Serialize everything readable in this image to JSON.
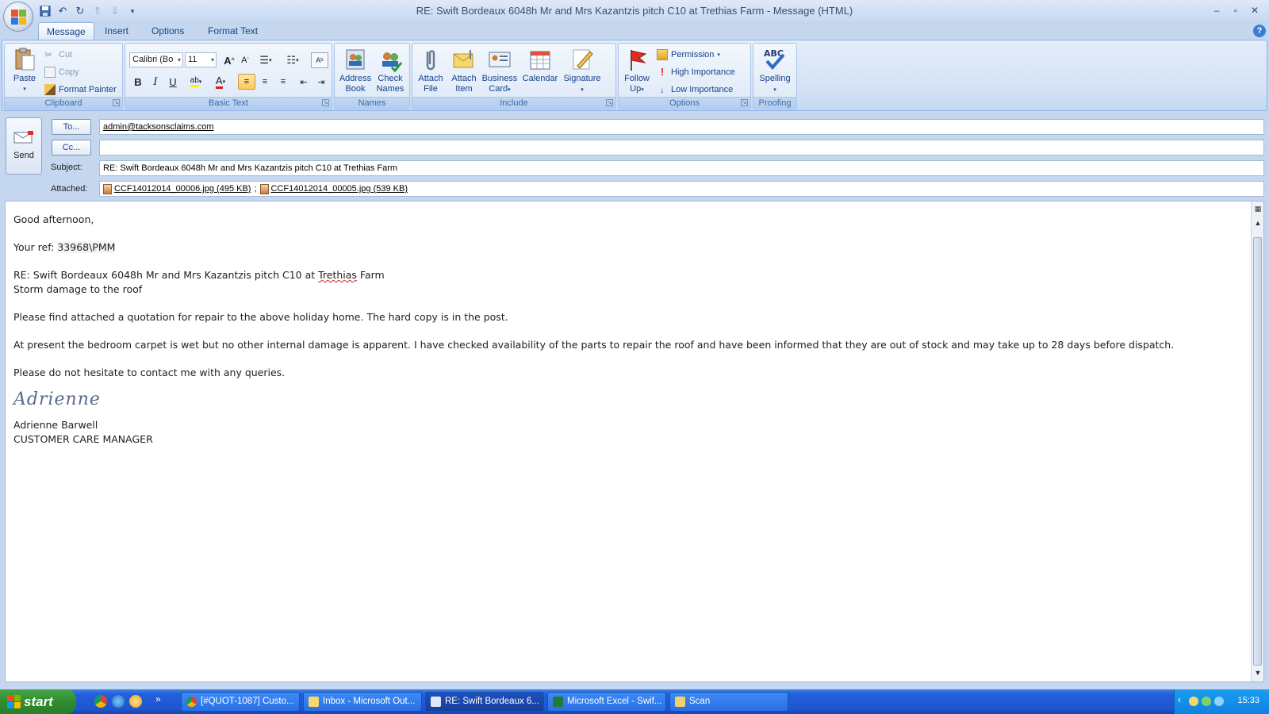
{
  "window": {
    "title": "RE: Swift Bordeaux 6048h Mr and Mrs Kazantzis pitch C10 at Trethias Farm - Message (HTML)",
    "controls": [
      "–",
      "▫",
      "✕"
    ]
  },
  "tabs": [
    "Message",
    "Insert",
    "Options",
    "Format Text"
  ],
  "ribbon": {
    "clipboard": {
      "label": "Clipboard",
      "paste": "Paste",
      "cut": "Cut",
      "copy": "Copy",
      "format_painter": "Format Painter"
    },
    "basic_text": {
      "label": "Basic Text",
      "font": "Calibri (Bo",
      "size": "11"
    },
    "names": {
      "label": "Names",
      "address_book": [
        "Address",
        "Book"
      ],
      "check_names": [
        "Check",
        "Names"
      ]
    },
    "include": {
      "label": "Include",
      "attach_file": [
        "Attach",
        "File"
      ],
      "attach_item": [
        "Attach",
        "Item"
      ],
      "business_card": [
        "Business",
        "Card"
      ],
      "calendar": "Calendar",
      "signature": "Signature"
    },
    "options": {
      "label": "Options",
      "follow_up": [
        "Follow",
        "Up"
      ],
      "permission": "Permission",
      "high_importance": "High Importance",
      "low_importance": "Low Importance"
    },
    "proofing": {
      "label": "Proofing",
      "spelling": "Spelling",
      "abc": "ABC"
    }
  },
  "header": {
    "send": "Send",
    "to_button": "To...",
    "cc_button": "Cc...",
    "subject_label": "Subject:",
    "attached_label": "Attached:",
    "to_value": "admin@tacksonsclaims.com",
    "cc_value": "",
    "subject_value": "RE: Swift Bordeaux 6048h Mr and Mrs Kazantzis pitch C10 at Trethias Farm",
    "attachments": [
      "CCF14012014_00006.jpg (495 KB)",
      "CCF14012014_00005.jpg (539 KB)"
    ],
    "attachment_separator": ";"
  },
  "message": {
    "greeting": "Good afternoon,",
    "ref_prefix": "Your ref: ",
    "ref_value": "33968\\PMM",
    "re_line_a": "RE: Swift Bordeaux 6048h Mr and Mrs Kazantzis pitch C10 at ",
    "re_line_b": "Trethias",
    "re_line_c": " Farm",
    "storm_line": "Storm damage to the roof",
    "para1": "Please find attached a quotation for repair to the above holiday home.  The hard copy is in the post.",
    "para2": "At present the bedroom carpet is wet but no other internal damage is apparent.  I have checked availability of the parts to repair the roof and have been informed that they are out of stock and may take up to 28 days before dispatch.",
    "para3": "Please do not hesitate to contact me with any queries.",
    "signature_script": "Adrienne",
    "sig_name": "Adrienne Barwell",
    "sig_title": "CUSTOMER CARE MANAGER"
  },
  "taskbar": {
    "start": "start",
    "more": "»",
    "tasks": [
      "[#QUOT-1087] Custo...",
      "Inbox - Microsoft Out...",
      "RE: Swift Bordeaux 6...",
      "Microsoft Excel - Swif...",
      "Scan"
    ],
    "clock": "15:33"
  },
  "colors": {
    "ribbon_text": "#15428b",
    "taskbar_blue": "#245edb",
    "start_green": "#2f8d2f",
    "active_tab": "#ffffff"
  }
}
